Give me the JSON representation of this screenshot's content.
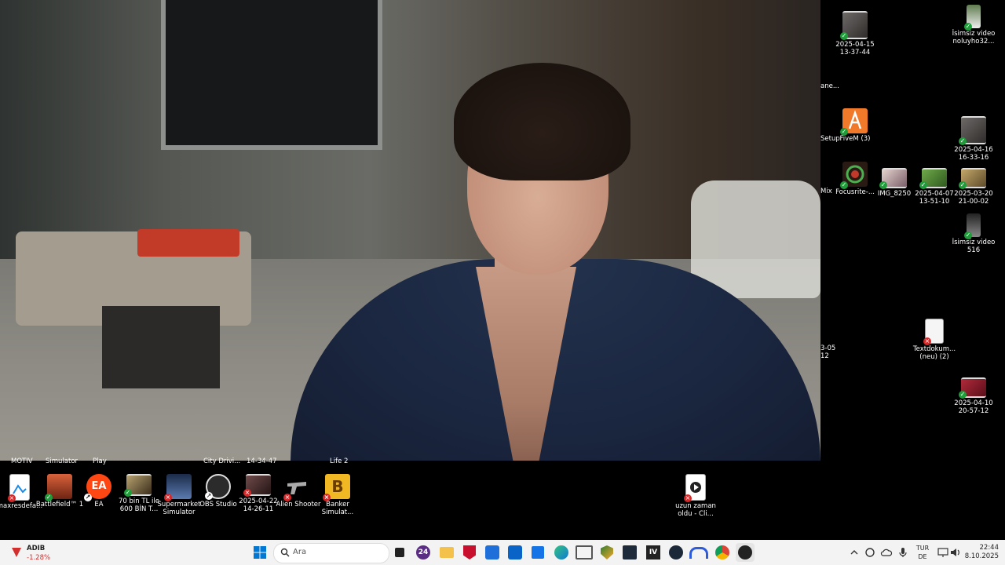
{
  "desktop": {
    "cut_labels": [
      "MOTIV",
      "Simulator",
      "Play",
      "City Drivi...",
      "14-34-47",
      "Life 2",
      "ane...",
      "Setup",
      "Mix",
      "3-05",
      "12"
    ],
    "right_icons": [
      {
        "label": "2025-04-15\n13-37-44",
        "icon": "video-thumbnail-icon",
        "status": "ok"
      },
      {
        "label": "İsimsiz video\nnoluyho32...",
        "icon": "video-file-icon",
        "status": "ok"
      },
      {
        "label": "FiveM (3)",
        "icon": "fivem-icon",
        "status": "ok"
      },
      {
        "label": "2025-04-16\n16-33-16",
        "icon": "video-thumbnail-icon",
        "status": "ok"
      },
      {
        "label": "Focusrite-...",
        "icon": "focusrite-icon",
        "status": "ok"
      },
      {
        "label": "IMG_8250",
        "icon": "image-thumbnail-icon",
        "status": "ok"
      },
      {
        "label": "2025-04-07\n13-51-10",
        "icon": "video-thumbnail-icon",
        "status": "ok"
      },
      {
        "label": "2025-03-20\n21-00-02",
        "icon": "video-thumbnail-icon",
        "status": "ok"
      },
      {
        "label": "İsimsiz video\n516",
        "icon": "video-file-icon",
        "status": "ok"
      },
      {
        "label": "Textdokum...\n(neu) (2)",
        "icon": "text-document-icon",
        "status": "err"
      },
      {
        "label": "2025-04-10\n20-57-12",
        "icon": "video-thumbnail-icon",
        "status": "ok"
      }
    ],
    "bottom_icons": [
      {
        "label": "maxresdefa...",
        "icon": "image-file-icon",
        "status": "err"
      },
      {
        "label": "Battlefield™ 1",
        "icon": "battlefield-icon",
        "status": "ok"
      },
      {
        "label": "EA",
        "icon": "ea-icon",
        "status": "shortcut"
      },
      {
        "label": "70 bin TL ile\n600 BİN T...",
        "icon": "video-thumbnail-icon",
        "status": "ok"
      },
      {
        "label": "Supermarket\nSimulator",
        "icon": "supermarket-simulator-icon",
        "status": "err"
      },
      {
        "label": "OBS Studio",
        "icon": "obs-icon",
        "status": "shortcut"
      },
      {
        "label": "2025-04-22\n14-26-11",
        "icon": "video-thumbnail-icon",
        "status": "err"
      },
      {
        "label": "Alien Shooter",
        "icon": "alien-shooter-icon",
        "status": "err"
      },
      {
        "label": "Banker\nSimulat...",
        "icon": "banker-simulator-icon",
        "status": "err"
      },
      {
        "label": "uzun zaman\noldu - Cli...",
        "icon": "media-file-icon",
        "status": "err"
      }
    ]
  },
  "taskbar": {
    "weather": {
      "name": "ADIB",
      "value": "-1.28%"
    },
    "search_placeholder": "Ara",
    "pinned": [
      "windows-start-icon",
      "task-view-icon",
      "24-icon",
      "file-explorer-icon",
      "mcafee-icon",
      "text-app-icon",
      "outlook-icon",
      "store-icon",
      "edge-icon",
      "photos-icon",
      "shield-app-icon",
      "photo-editor-icon",
      "iv-icon",
      "steam-icon",
      "arc-icon",
      "chrome-icon",
      "obs-icon"
    ],
    "tray": {
      "lang_top": "TUR",
      "lang_bottom": "DE",
      "time": "22:44",
      "date": "8.10.2025"
    }
  }
}
